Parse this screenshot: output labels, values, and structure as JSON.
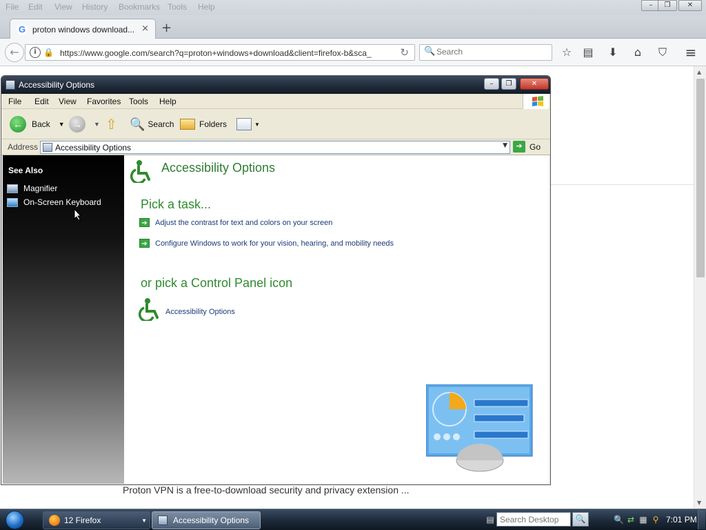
{
  "firefox": {
    "menu": [
      "File",
      "Edit",
      "View",
      "History",
      "Bookmarks",
      "Tools",
      "Help"
    ],
    "tab_title": "proton windows download...",
    "url": "https://www.google.com/search?q=proton+windows+download&client=firefox-b&sca_",
    "search_placeholder": "Search",
    "window_controls": {
      "minimize": "–",
      "restore": "❐",
      "close": "✕"
    },
    "icons": {
      "close_tab": "×",
      "new_tab": "+",
      "reload": "↻",
      "bookmark": "☆",
      "reader": "▤",
      "download": "⬇",
      "home": "⌂",
      "pocket": "⛉",
      "menu": "≡",
      "search": "🔍",
      "back": "←"
    }
  },
  "page": {
    "snippet": "Proton VPN is a free-to-download security and privacy extension ..."
  },
  "explorer": {
    "title": "Accessibility Options",
    "menu": [
      "File",
      "Edit",
      "View",
      "Favorites",
      "Tools",
      "Help"
    ],
    "toolbar": {
      "back": "Back",
      "search": "Search",
      "folders": "Folders"
    },
    "address_label": "Address",
    "address_value": "Accessibility Options",
    "go_label": "Go",
    "see_also": {
      "heading": "See Also",
      "items": [
        "Magnifier",
        "On-Screen Keyboard"
      ]
    },
    "main": {
      "title": "Accessibility Options",
      "pick_task": "Pick a task...",
      "tasks": [
        "Adjust the contrast for text and colors on your screen",
        "Configure Windows to work for your vision, hearing, and mobility needs"
      ],
      "pick_icon": "or pick a Control Panel icon",
      "icon_label": "Accessibility Options"
    },
    "colors": {
      "heading_green": "#2e8b2e",
      "link_blue": "#1a3c78",
      "task_arrow": "#3aa843"
    }
  },
  "taskbar": {
    "tasks": [
      {
        "label": "12 Firefox"
      },
      {
        "label": "Accessibility Options"
      }
    ],
    "search_placeholder": "Search Desktop",
    "clock": "7:01 PM"
  }
}
